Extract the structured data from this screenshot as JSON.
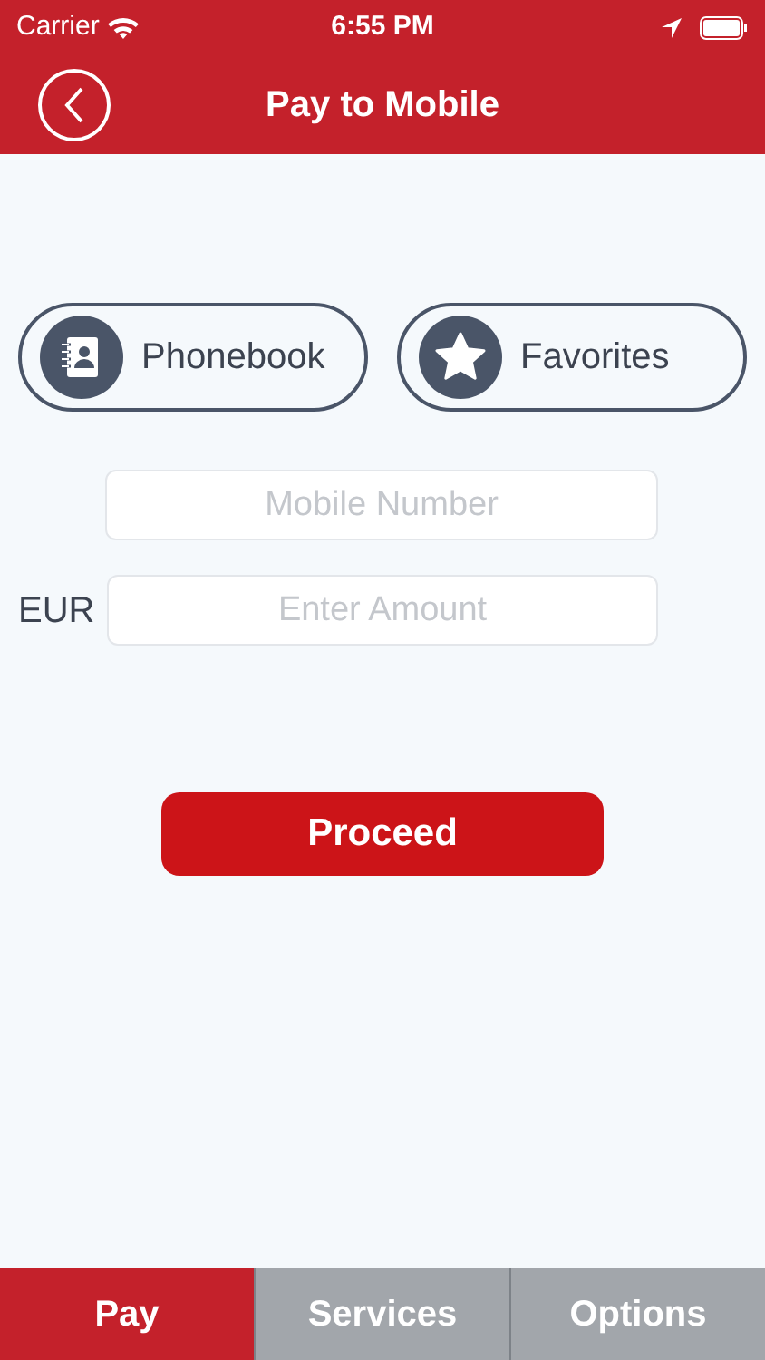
{
  "status_bar": {
    "carrier": "Carrier",
    "time": "6:55 PM"
  },
  "nav": {
    "title": "Pay to Mobile"
  },
  "shortcuts": [
    {
      "kind": "contacts",
      "label": "Phonebook"
    },
    {
      "kind": "star",
      "label": "Favorites"
    }
  ],
  "fields": [
    {
      "placeholder": "Mobile Number"
    },
    {
      "prefix": "EUR",
      "placeholder": "Enter Amount"
    }
  ],
  "proceed_button": "Proceed",
  "tabs": [
    {
      "label": "Pay",
      "selected": true
    },
    {
      "label": "Services",
      "selected": false
    },
    {
      "label": "Options",
      "selected": false
    }
  ]
}
